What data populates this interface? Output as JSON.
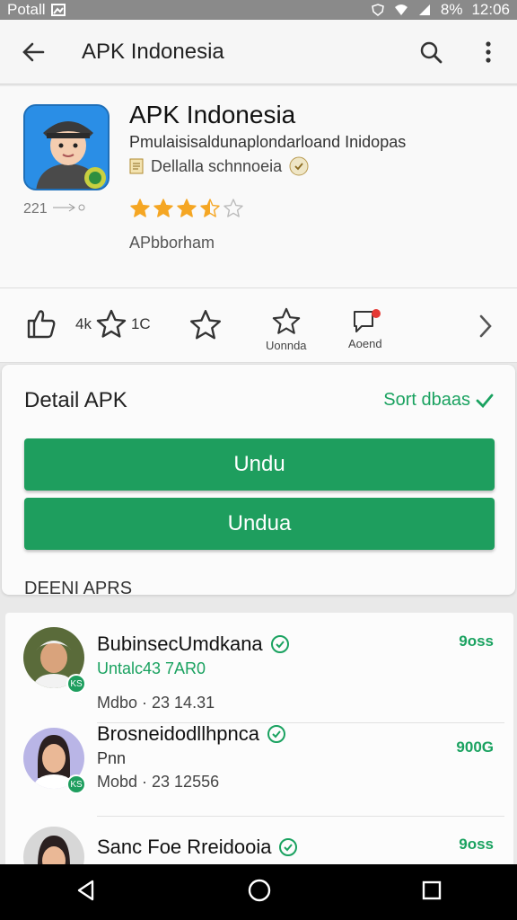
{
  "status_bar": {
    "carrier": "Potall",
    "battery": "8%",
    "time": "12:06"
  },
  "app_bar": {
    "title": "APK Indonesia"
  },
  "app": {
    "name": "APK Indonesia",
    "subtitle": "Pmulaisisaldunaplondarloand Inidopas",
    "developer": "Dellalla schnnoeia",
    "version": "221",
    "rating": 3.5,
    "author": "APbborham"
  },
  "actions": {
    "count_text": "4k",
    "count_text_2": "1C",
    "label_3": "Uonnda",
    "label_4": "Aoend"
  },
  "detail": {
    "title": "Detail APK",
    "status": "Sort dbaas",
    "button_1": "Undu",
    "button_2": "Undua",
    "footer": "DEENI APRS"
  },
  "reviews": [
    {
      "name": "BubinsecUmdkana",
      "meta1": "Untalc43 7AR0",
      "meta2": "Mdbo · 23 14.31",
      "score": "9oss",
      "badge": "KS",
      "meta1_color": "#1aa260"
    },
    {
      "name": "Brosneidodllhpnca",
      "meta1": "Pnn",
      "meta2": "Mobd · 23 12556",
      "score": "900G",
      "badge": "KS",
      "meta1_color": "#333333"
    },
    {
      "name": "Sanc Foe Rreidooia",
      "meta1": "",
      "meta2": "",
      "score": "9oss",
      "badge": "",
      "meta1_color": "#333333"
    }
  ],
  "colors": {
    "accent": "#1e9e5e",
    "star": "#f5a623"
  },
  "icons": [
    "back-arrow-icon",
    "search-icon",
    "more-vert-icon",
    "thumbs-up-icon",
    "star-icon",
    "chevron-right-icon",
    "back-triangle-icon",
    "home-circle-icon",
    "recents-square-icon"
  ]
}
